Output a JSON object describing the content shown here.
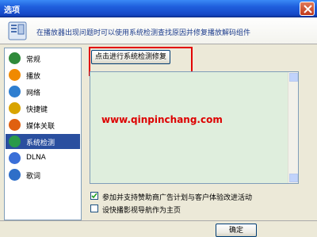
{
  "window": {
    "title": "选项"
  },
  "header": {
    "description": "在播放器出现问题时可以使用系统检测查找原因并修复播放解码组件"
  },
  "sidebar": {
    "items": [
      {
        "label": "常规",
        "icon": "settings-icon",
        "color": "#2f8a3a"
      },
      {
        "label": "播放",
        "icon": "play-icon",
        "color": "#f08a00"
      },
      {
        "label": "网络",
        "icon": "network-icon",
        "color": "#2f7fd0"
      },
      {
        "label": "快捷键",
        "icon": "keyboard-icon",
        "color": "#d8a400"
      },
      {
        "label": "媒体关联",
        "icon": "media-association-icon",
        "color": "#e06010"
      },
      {
        "label": "系统检测",
        "icon": "system-check-icon",
        "color": "#2a9a4a",
        "selected": true
      },
      {
        "label": "DLNA",
        "icon": "dlna-icon",
        "color": "#3a6fd8"
      },
      {
        "label": "歌词",
        "icon": "lyrics-icon",
        "color": "#2f6fc8"
      }
    ]
  },
  "main": {
    "diagnose_button": "点击进行系统检测修复",
    "watermark": "www.qinpinchang.com",
    "options": [
      {
        "label": "参加并支持赞助商广告计划与客户体验改进活动",
        "checked": true
      },
      {
        "label": "设快播影视导航作为主页",
        "checked": false
      }
    ]
  },
  "footer": {
    "ok_button": "确定"
  }
}
